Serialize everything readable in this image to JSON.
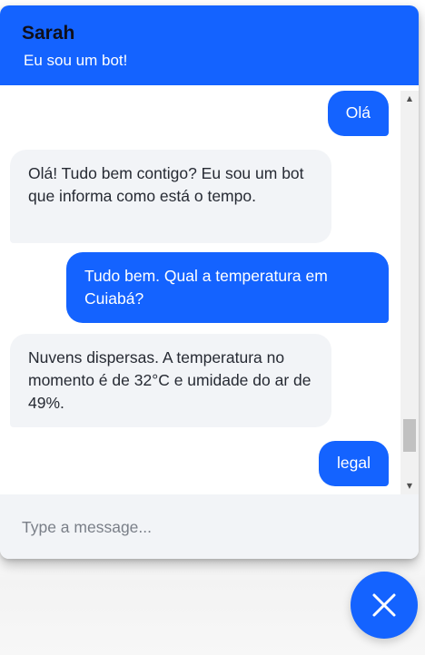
{
  "header": {
    "title": "Sarah",
    "subtitle": "Eu sou um bot!"
  },
  "messages": [
    {
      "sender": "user",
      "text": "Olá"
    },
    {
      "sender": "bot",
      "text": "Olá! Tudo bem contigo? Eu sou um bot que informa como está o tempo."
    },
    {
      "sender": "user",
      "text": "Tudo bem. Qual a temperatura em Cuiabá?"
    },
    {
      "sender": "bot",
      "text": "Nuvens dispersas. A temperatura no momento é de 32°C e umidade do ar de 49%."
    },
    {
      "sender": "user",
      "text": "legal"
    }
  ],
  "composer": {
    "placeholder": "Type a message..."
  },
  "icons": {
    "close": "close-icon",
    "scroll_up": "arrow-up-icon",
    "scroll_down": "arrow-down-icon"
  },
  "colors": {
    "accent": "#1463ff",
    "bot_bubble": "#f2f4f7",
    "title_text": "#0f0f1a"
  }
}
